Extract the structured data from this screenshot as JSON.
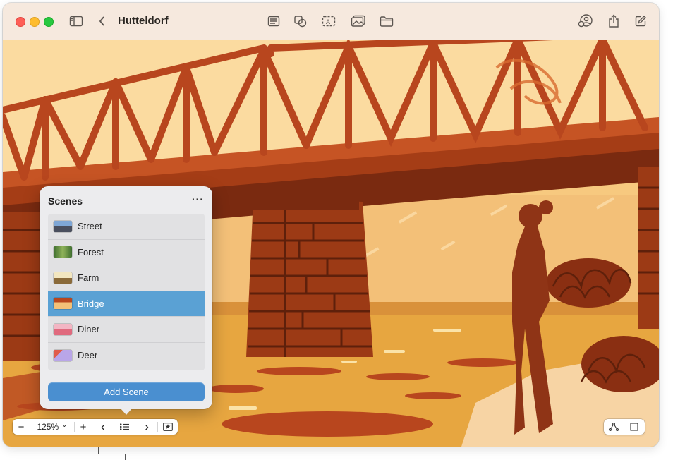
{
  "window": {
    "title": "Hutteldorf"
  },
  "toolbar": {
    "icons": [
      "sidebar-icon",
      "back-chevron-icon",
      "text-box-icon",
      "shapes-icon",
      "text-frame-icon",
      "media-icon",
      "folder-icon",
      "collaborate-icon",
      "share-icon",
      "compose-icon"
    ]
  },
  "scenes_panel": {
    "title": "Scenes",
    "more": "···",
    "items": [
      {
        "label": "Street",
        "selected": false
      },
      {
        "label": "Forest",
        "selected": false
      },
      {
        "label": "Farm",
        "selected": false
      },
      {
        "label": "Bridge",
        "selected": true
      },
      {
        "label": "Diner",
        "selected": false
      },
      {
        "label": "Deer",
        "selected": false
      }
    ],
    "add_button": "Add Scene"
  },
  "bottom_bar": {
    "zoom_out": "−",
    "zoom_value": "125%",
    "zoom_chevron": "⌄",
    "zoom_in": "+",
    "prev": "‹",
    "next": "›"
  },
  "colors": {
    "accent_selected": "#5aa1d4",
    "add_button": "#4a8fd0",
    "bridge_red": "#b8461e",
    "sky": "#fbd89a"
  }
}
